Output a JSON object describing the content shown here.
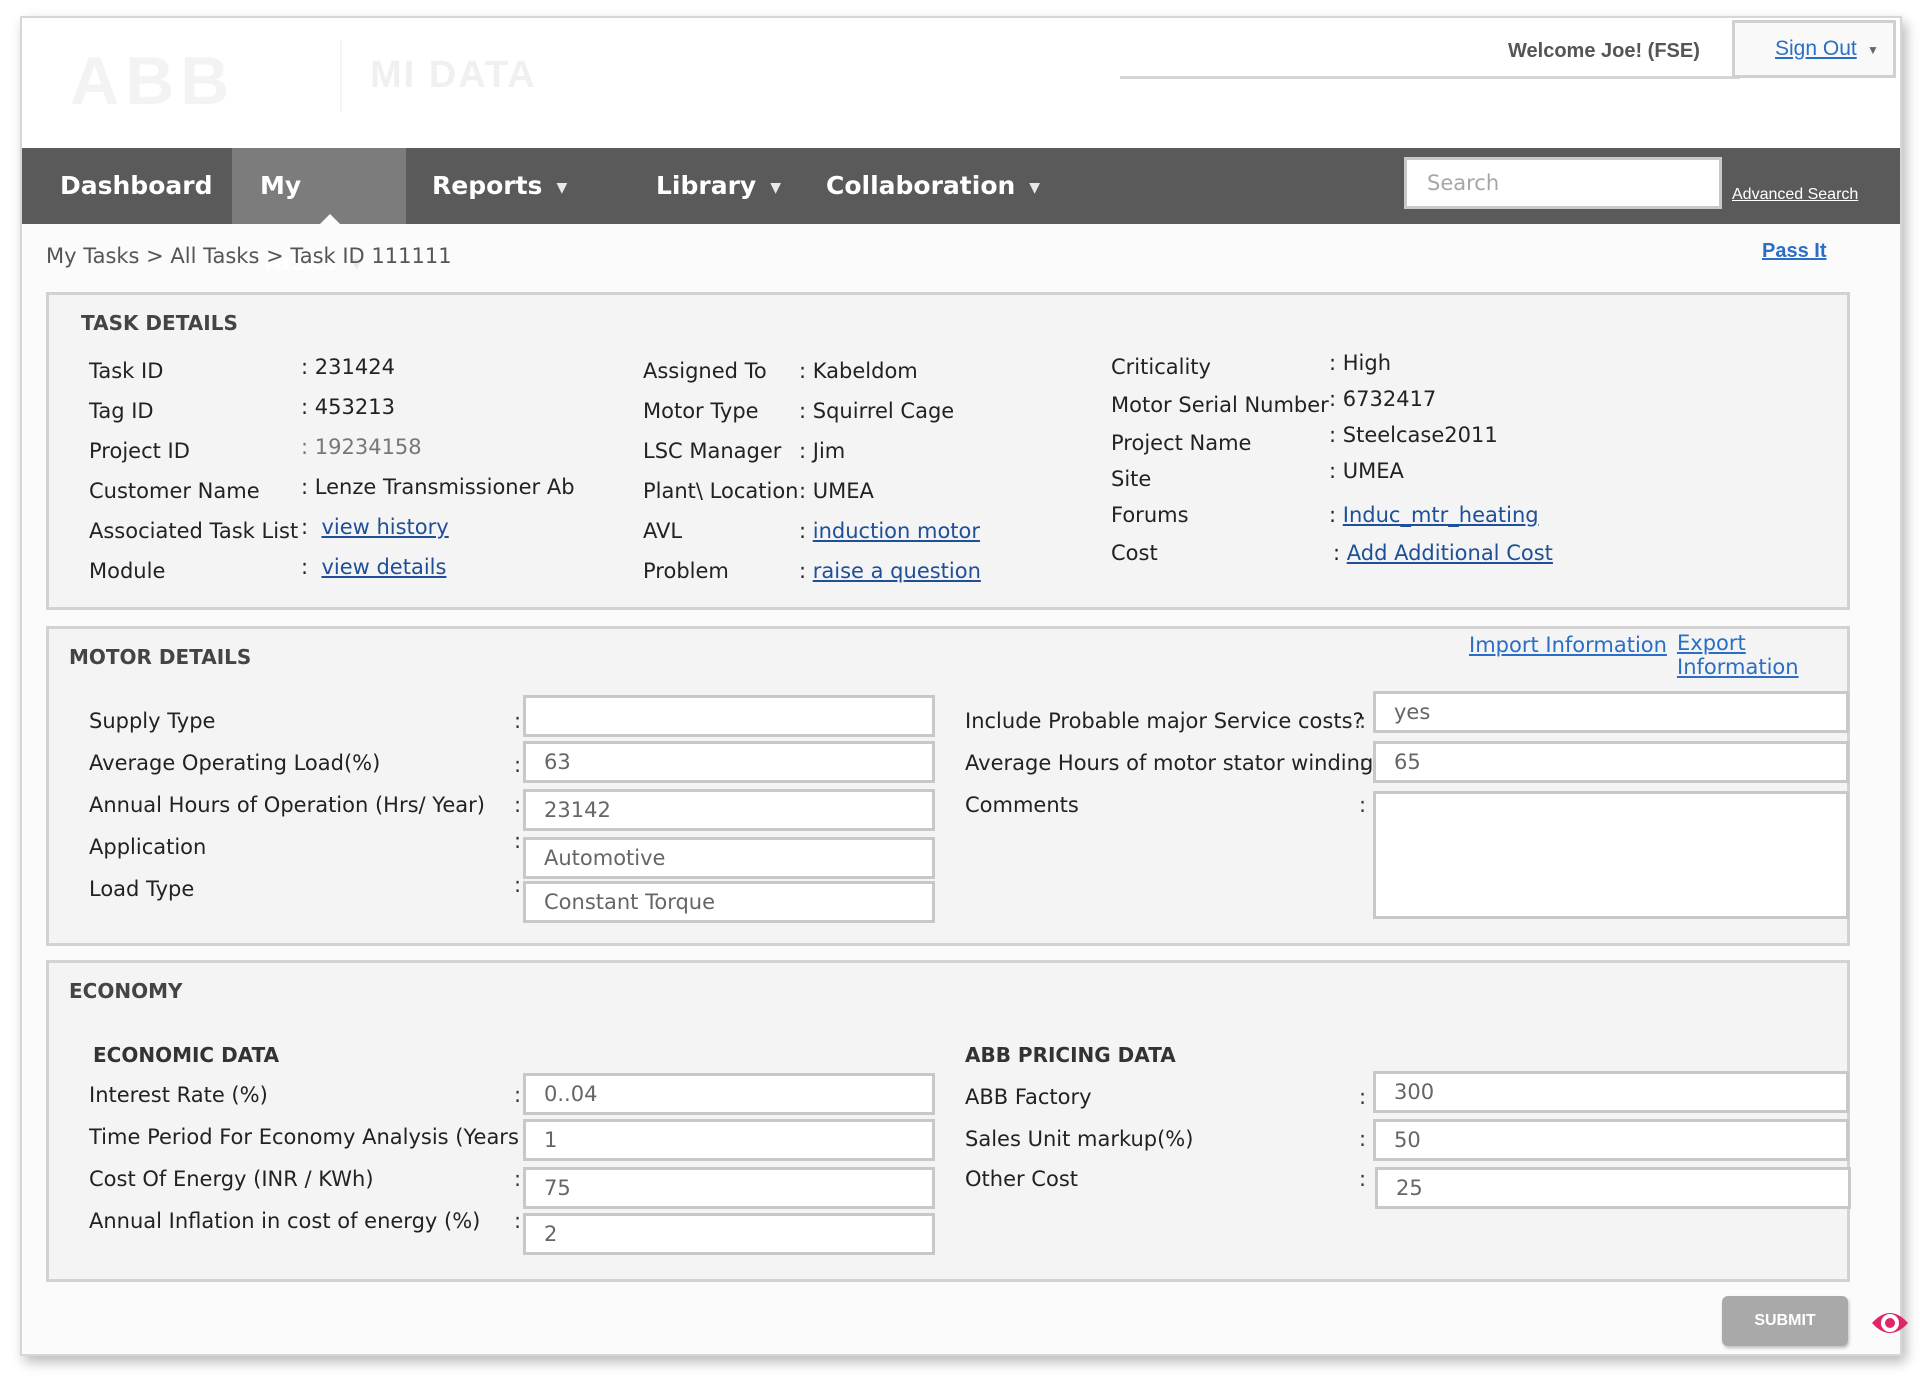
{
  "header": {
    "logo": "ABB",
    "product": "MI  DATA",
    "welcome": "Welcome Joe!  (FSE)",
    "sign_out": "Sign Out"
  },
  "nav": {
    "items": [
      {
        "label": "Dashboard"
      },
      {
        "label": "My Tasks"
      },
      {
        "label": "Reports"
      },
      {
        "label": "Library"
      },
      {
        "label": "Collaboration"
      }
    ],
    "search_placeholder": "Search",
    "advanced_search": "Advanced Search"
  },
  "breadcrumb": "My Tasks > All Tasks > Task ID 111111",
  "pass_it": "Pass It",
  "task_details": {
    "title": "TASK DETAILS",
    "col1": [
      {
        "label": "Task ID",
        "value": "231424"
      },
      {
        "label": "Tag ID",
        "value": "453213"
      },
      {
        "label": "Project ID",
        "value": "19234158"
      },
      {
        "label": "Customer Name",
        "value": "Lenze Transmissioner Ab"
      },
      {
        "label": "Associated Task List",
        "value": "view history"
      },
      {
        "label": "Module",
        "value": "view details"
      }
    ],
    "col2": [
      {
        "label": "Assigned To",
        "value": "Kabeldom"
      },
      {
        "label": "Motor Type",
        "value": "Squirrel Cage"
      },
      {
        "label": "LSC Manager",
        "value": "Jim"
      },
      {
        "label": "Plant\\ Location",
        "value": "UMEA"
      },
      {
        "label": "AVL",
        "value": "induction motor"
      },
      {
        "label": "Problem",
        "value": "raise a question"
      }
    ],
    "col3": [
      {
        "label": "Criticality",
        "value": "High"
      },
      {
        "label": "Motor Serial Number",
        "value": "6732417"
      },
      {
        "label": "Project Name",
        "value": "Steelcase2011"
      },
      {
        "label": "Site",
        "value": "UMEA"
      },
      {
        "label": "Forums",
        "value": "Induc_mtr_heating"
      },
      {
        "label": "Cost",
        "value": "Add Additional Cost"
      }
    ]
  },
  "motor_details": {
    "title": "MOTOR DETAILS",
    "import": "Import Information",
    "export": "Export Information",
    "left": [
      {
        "label": "Supply Type",
        "value": ""
      },
      {
        "label": "Average Operating Load(%)",
        "value": "63"
      },
      {
        "label": "Annual Hours of Operation (Hrs/ Year)",
        "value": "23142"
      },
      {
        "label": "Application",
        "value": "Automotive"
      },
      {
        "label": "Load Type",
        "value": "Constant Torque"
      }
    ],
    "right": [
      {
        "label": "Include Probable major Service costs?",
        "value": "yes"
      },
      {
        "label": "Average Hours of motor stator winding",
        "value": "65"
      },
      {
        "label": "Comments",
        "value": ""
      }
    ]
  },
  "economy": {
    "title": "ECONOMY",
    "economic_title": "ECONOMIC DATA",
    "pricing_title": "ABB PRICING DATA",
    "economic": [
      {
        "label": "Interest Rate (%)",
        "value": "0..04"
      },
      {
        "label": "Time Period For Economy Analysis (Years",
        "value": "1"
      },
      {
        "label": "Cost Of Energy (INR / KWh)",
        "value": "75"
      },
      {
        "label": "Annual Inflation in cost of energy (%)",
        "value": "2"
      }
    ],
    "pricing": [
      {
        "label": "ABB Factory",
        "value": "300"
      },
      {
        "label": "Sales Unit markup(%)",
        "value": "50"
      },
      {
        "label": "Other Cost",
        "value": "25"
      }
    ]
  },
  "submit": "SUBMIT",
  "colors": {
    "nav_bg": "#5a5a5a",
    "nav_active": "#7c7c7c",
    "link": "#1e4f97",
    "eye_icon": "#e0256b"
  }
}
